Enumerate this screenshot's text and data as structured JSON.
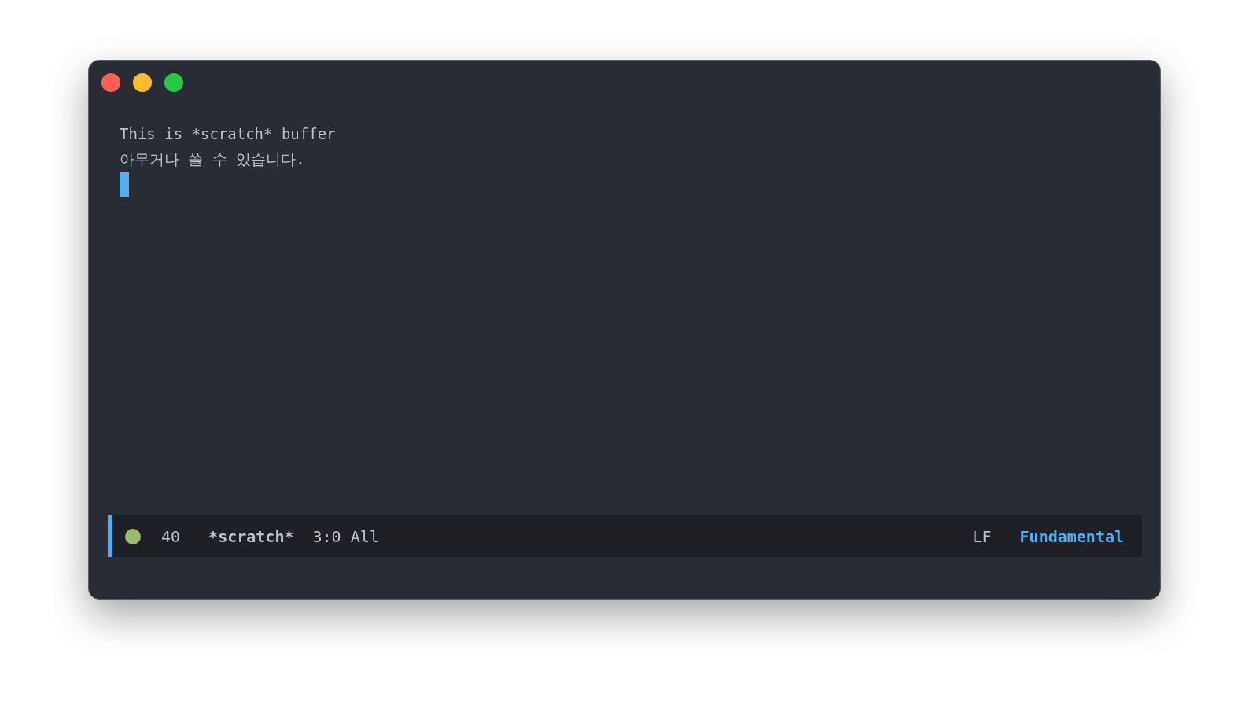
{
  "buffer": {
    "lines": [
      "This is *scratch* buffer",
      "아무거나 쓸 수 있습니다."
    ]
  },
  "mode_line": {
    "count": "40",
    "buffer_name": "*scratch*",
    "position": "3:0 All",
    "line_ending": "LF",
    "major_mode": "Fundamental"
  }
}
